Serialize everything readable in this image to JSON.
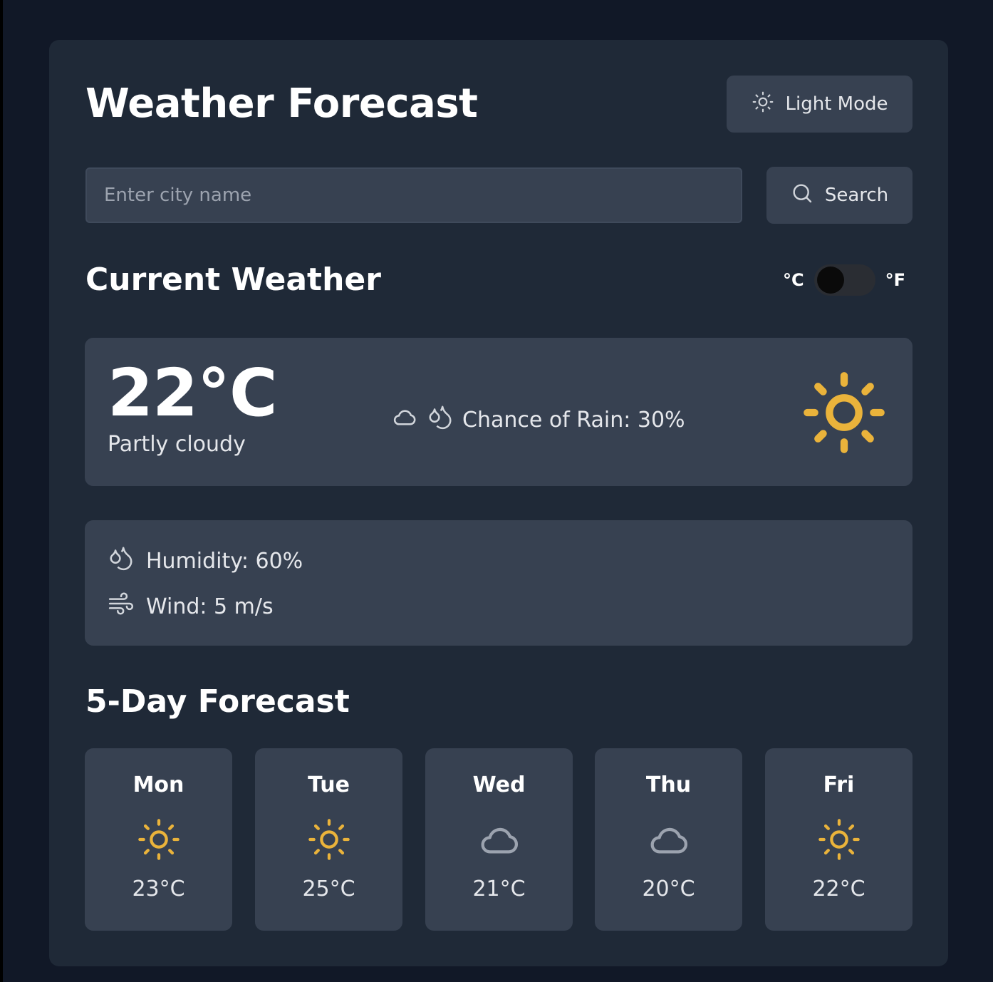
{
  "header": {
    "title": "Weather Forecast",
    "mode_button_label": "Light Mode",
    "mode_button_icon": "sun-icon"
  },
  "search": {
    "placeholder": "Enter city name",
    "value": "",
    "button_label": "Search",
    "button_icon": "search-icon"
  },
  "current": {
    "section_title": "Current Weather",
    "unit_toggle": {
      "left_label": "°C",
      "right_label": "°F",
      "selected": "°C"
    },
    "temperature": "22°C",
    "description": "Partly cloudy",
    "rain_text": "Chance of Rain: 30%",
    "rain_icons": [
      "cloud-icon",
      "droplets-icon"
    ],
    "main_icon": "sun-icon",
    "humidity_text": "Humidity: 60%",
    "humidity_icon": "droplets-icon",
    "wind_text": "Wind: 5 m/s",
    "wind_icon": "wind-icon"
  },
  "forecast": {
    "section_title": "5-Day Forecast",
    "days": [
      {
        "day": "Mon",
        "temp": "23°C",
        "icon": "sun-icon"
      },
      {
        "day": "Tue",
        "temp": "25°C",
        "icon": "sun-icon"
      },
      {
        "day": "Wed",
        "temp": "21°C",
        "icon": "cloud-icon"
      },
      {
        "day": "Thu",
        "temp": "20°C",
        "icon": "cloud-icon"
      },
      {
        "day": "Fri",
        "temp": "22°C",
        "icon": "sun-icon"
      }
    ]
  },
  "colors": {
    "page_bg": "#111827",
    "card_bg": "#1f2937",
    "panel_bg": "#374151",
    "sun": "#eab33b",
    "cloud": "#9ca3af",
    "text": "#ffffff"
  }
}
